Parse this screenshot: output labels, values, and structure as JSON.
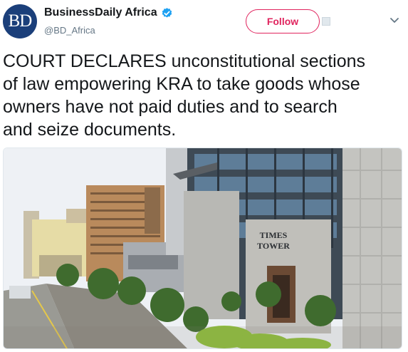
{
  "account": {
    "avatar_initials": "BD",
    "display_name": "BusinessDaily Africa",
    "handle": "@BD_Africa",
    "verified": true
  },
  "actions": {
    "follow_label": "Follow"
  },
  "tweet": {
    "text": "COURT DECLARES unconstitutional sections\nof law empowering KRA to take goods whose\nowners have not paid duties and to search\nand seize documents."
  },
  "photo": {
    "signage": "TIMES\nTOWER"
  },
  "colors": {
    "follow_accent": "#e0245e",
    "verified_blue": "#1da1f2",
    "avatar_bg": "#1b3f7a",
    "handle_gray": "#657786"
  },
  "icons": [
    "verified-badge-icon",
    "follow-extra-icon",
    "chevron-down-icon"
  ]
}
